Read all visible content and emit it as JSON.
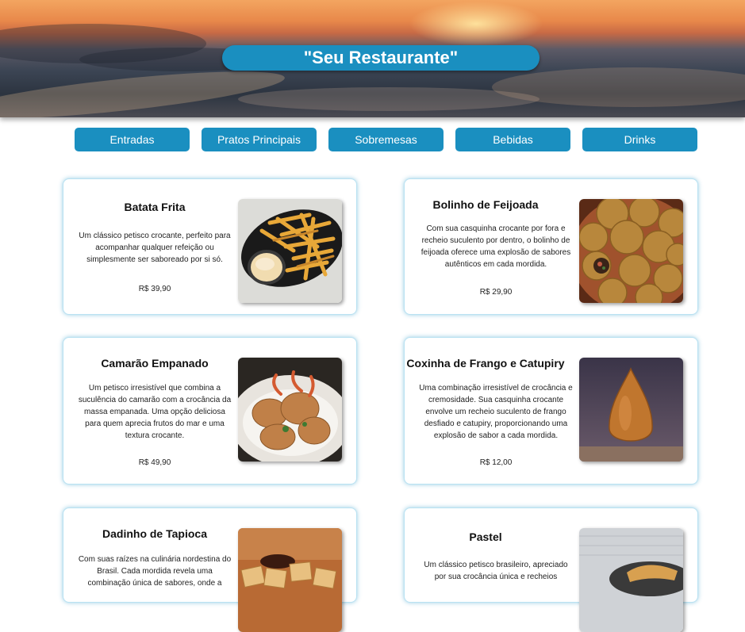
{
  "header": {
    "title": "\"Seu Restaurante\""
  },
  "nav": {
    "items": [
      {
        "label": "Entradas"
      },
      {
        "label": "Pratos Principais"
      },
      {
        "label": "Sobremesas"
      },
      {
        "label": "Bebidas"
      },
      {
        "label": "Drinks"
      }
    ]
  },
  "colors": {
    "accent": "#1a8fc0",
    "card_border": "#b9e2f2"
  },
  "menu": {
    "items": [
      {
        "name": "Batata Frita",
        "description": "Um clássico petisco crocante, perfeito para acompanhar qualquer refeição ou simplesmente ser saboreado por si só.",
        "price": "R$ 39,90",
        "image": "french-fries-photo"
      },
      {
        "name": "Bolinho de Feijoada",
        "description": "Com sua casquinha crocante por fora e recheio suculento por dentro, o bolinho de feijoada oferece uma explosão de sabores autênticos em cada mordida.",
        "price": "R$ 29,90",
        "image": "feijoada-balls-photo"
      },
      {
        "name": "Camarão Empanado",
        "description": "Um petisco irresistível que combina a suculência do camarão com a crocância da massa empanada. Uma opção deliciosa para quem aprecia frutos do mar e uma textura crocante.",
        "price": "R$ 49,90",
        "image": "breaded-shrimp-photo"
      },
      {
        "name": "Coxinha de Frango e Catupiry",
        "description": "Uma combinação irresistível de crocância e cremosidade. Sua casquinha crocante envolve um recheio suculento de frango desfiado e catupiry, proporcionando uma explosão de sabor a cada mordida.",
        "price": "R$ 12,00",
        "image": "coxinha-photo"
      },
      {
        "name": "Dadinho de Tapioca",
        "description": "Com suas raízes na culinária nordestina do Brasil. Cada mordida revela uma combinação única de sabores, onde a",
        "price": "",
        "image": "tapioca-cubes-photo"
      },
      {
        "name": "Pastel",
        "description": "Um clássico petisco brasileiro, apreciado por sua crocância única e recheios",
        "price": "",
        "image": "pastel-photo"
      }
    ]
  }
}
